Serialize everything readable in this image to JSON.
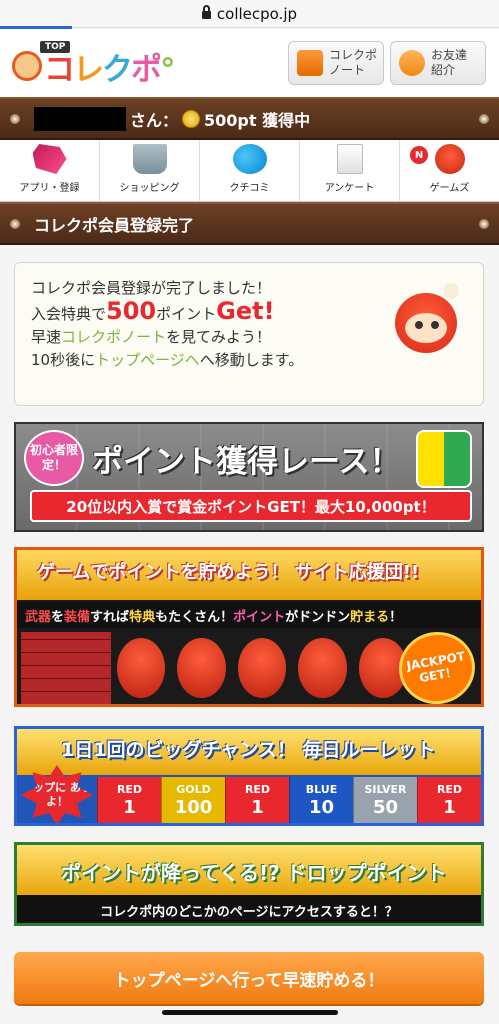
{
  "browser": {
    "url": "collecpo.jp"
  },
  "header": {
    "logo_top": "TOP",
    "logo_text": "コレクポ",
    "btn_note": "コレクポ\nノート",
    "btn_invite": "お友達\n紹介"
  },
  "userbar": {
    "suffix": "さん：",
    "points": "500pt 獲得中"
  },
  "nav": [
    {
      "label": "アプリ・登録"
    },
    {
      "label": "ショッピング"
    },
    {
      "label": "クチコミ"
    },
    {
      "label": "アンケート"
    },
    {
      "label": "ゲームズ",
      "badge": "N"
    }
  ],
  "section_title": "コレクポ会員登録完了",
  "message": {
    "line1": "コレクポ会員登録が完了しました！",
    "line2_pre": "入会特典で",
    "line2_num": "500",
    "line2_mid": "ポイント",
    "line2_get": "Get!",
    "line3_pre": "早速",
    "line3_link": "コレクポノート",
    "line3_post": "を見てみよう！",
    "line4_pre": "10秒後に",
    "line4_link": "トップページへ",
    "line4_post": "へ移動します。"
  },
  "banner_race": {
    "badge": "初心者限定！",
    "title": "ポイント獲得レース！",
    "sub": "20位以内入賞で賞金ポイントGET！最大10,000pt！"
  },
  "banner_game": {
    "title": "ゲームでポイントを貯めよう！ サイト応援団!!",
    "sub_r1": "武器",
    "sub_w1": "を",
    "sub_r2": "装備",
    "sub_w2": "すれば",
    "sub_y1": "特典",
    "sub_w3": "もたくさん！",
    "sub_p1": "ポイント",
    "sub_w4": "がドンドン",
    "sub_p2": "貯まる",
    "sub_w5": "！",
    "jackpot": "JACKPOT GET！"
  },
  "banner_roulette": {
    "title": "1日1回のビッグチャンス！ 毎日ルーレット",
    "star": "トップに あるよ！",
    "tiles": [
      {
        "name": "RED",
        "value": "1",
        "color": "#e8272e"
      },
      {
        "name": "GOLD",
        "value": "100",
        "color": "#e6b800"
      },
      {
        "name": "RED",
        "value": "1",
        "color": "#e8272e"
      },
      {
        "name": "BLUE",
        "value": "10",
        "color": "#1e57c4"
      },
      {
        "name": "SILVER",
        "value": "50",
        "color": "#9aa3ad"
      },
      {
        "name": "RED",
        "value": "1",
        "color": "#e8272e"
      }
    ]
  },
  "banner_drop": {
    "title": "ポイントが降ってくる!? ドロップポイント",
    "sub": "コレクポ内のどこかのページにアクセスすると！？"
  },
  "cta": {
    "label": "トップページへ行って早速貯める！"
  }
}
